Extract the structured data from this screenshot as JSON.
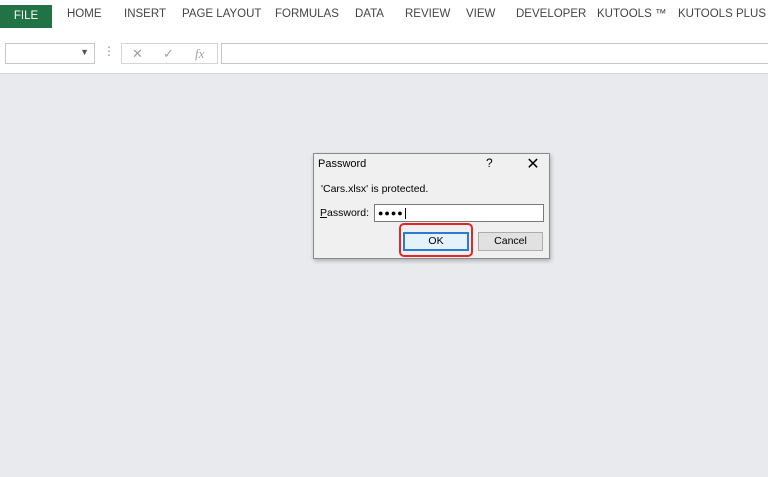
{
  "ribbon": {
    "tabs": [
      "FILE",
      "HOME",
      "INSERT",
      "PAGE LAYOUT",
      "FORMULAS",
      "DATA",
      "REVIEW",
      "VIEW",
      "DEVELOPER",
      "KUTOOLS ™",
      "KUTOOLS PLUS"
    ],
    "active_tab": "FILE",
    "active_color": "#217346"
  },
  "formula_bar": {
    "name_box_value": "",
    "separator": "⋮",
    "cancel_glyph": "✕",
    "enter_glyph": "✓",
    "fx_glyph": "fx",
    "formula_value": ""
  },
  "dialog": {
    "title": "Password",
    "help_glyph": "?",
    "close_glyph": "✕",
    "message": "'Cars.xlsx' is protected.",
    "password_label_hotkey": "P",
    "password_label_rest": "assword:",
    "password_value": "●●●●",
    "ok_label": "OK",
    "cancel_label": "Cancel",
    "highlight_color": "#e0282a"
  }
}
